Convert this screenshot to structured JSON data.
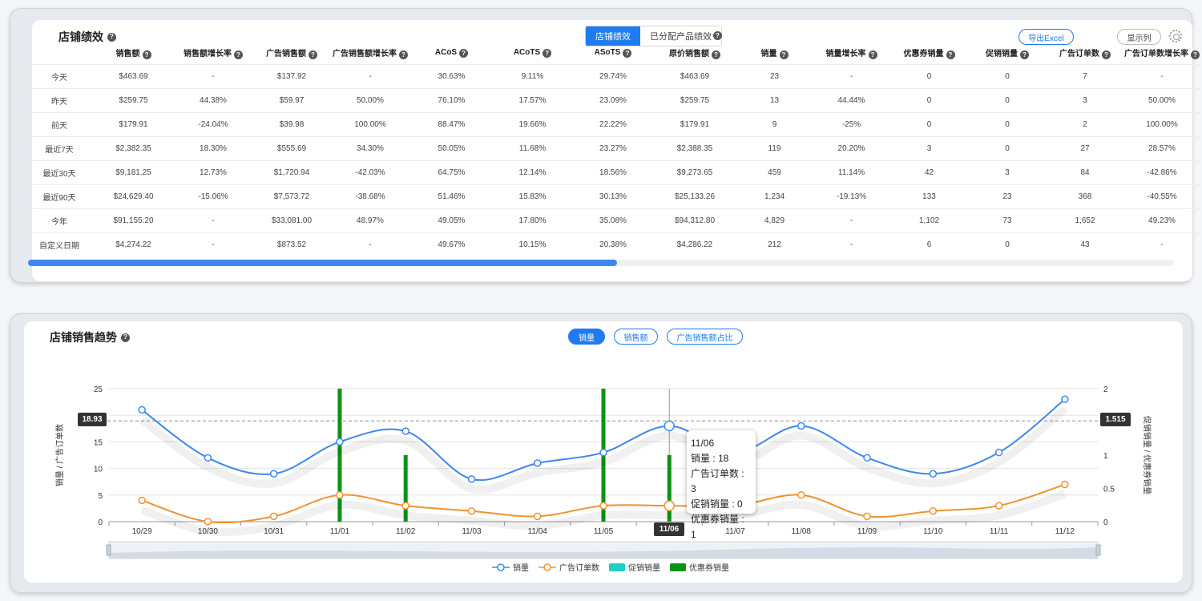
{
  "perf": {
    "title": "店铺绩效",
    "tabs": [
      {
        "label": "店铺绩效",
        "active": true
      },
      {
        "label": "已分配产品绩效",
        "active": false
      }
    ],
    "export_label": "导出Excel",
    "columns_label": "显示列",
    "headers": [
      "销售额",
      "销售额增长率",
      "广告销售额",
      "广告销售额增长率",
      "ACoS",
      "ACoTS",
      "ASoTS",
      "原价销售额",
      "销量",
      "销量增长率",
      "优惠券销量",
      "促销销量",
      "广告订单数",
      "广告订单数增长率"
    ],
    "rows": [
      {
        "label": "今天",
        "cells": [
          "$463.69",
          "-",
          "$137.92",
          "-",
          "30.63%",
          "9.11%",
          "29.74%",
          "$463.69",
          "23",
          "-",
          "0",
          "0",
          "7",
          "-"
        ]
      },
      {
        "label": "昨天",
        "cells": [
          "$259.75",
          "44.38%",
          "$59.97",
          "50.00%",
          "76.10%",
          "17.57%",
          "23.09%",
          "$259.75",
          "13",
          "44.44%",
          "0",
          "0",
          "3",
          "50.00%"
        ]
      },
      {
        "label": "前天",
        "cells": [
          "$179.91",
          "-24.04%",
          "$39.98",
          "100.00%",
          "88.47%",
          "19.66%",
          "22.22%",
          "$179.91",
          "9",
          "-25%",
          "0",
          "0",
          "2",
          "100.00%"
        ]
      },
      {
        "label": "最近7天",
        "cells": [
          "$2,382.35",
          "18.30%",
          "$555.69",
          "34.30%",
          "50.05%",
          "11.68%",
          "23.27%",
          "$2,388.35",
          "119",
          "20.20%",
          "3",
          "0",
          "27",
          "28.57%"
        ]
      },
      {
        "label": "最近30天",
        "cells": [
          "$9,181.25",
          "12.73%",
          "$1,720.94",
          "-42.03%",
          "64.75%",
          "12.14%",
          "18.56%",
          "$9,273.65",
          "459",
          "11.14%",
          "42",
          "3",
          "84",
          "-42.86%"
        ]
      },
      {
        "label": "最近90天",
        "cells": [
          "$24,629.40",
          "-15.06%",
          "$7,573.72",
          "-38.68%",
          "51.46%",
          "15.83%",
          "30.13%",
          "$25,133.26",
          "1,234",
          "-19.13%",
          "133",
          "23",
          "368",
          "-40.55%"
        ]
      },
      {
        "label": "今年",
        "cells": [
          "$91,155.20",
          "-",
          "$33,081.00",
          "48.97%",
          "49.05%",
          "17.80%",
          "35.08%",
          "$94,312.80",
          "4,829",
          "-",
          "1,102",
          "73",
          "1,652",
          "49.23%"
        ]
      },
      {
        "label": "自定义日期",
        "cells": [
          "$4,274.22",
          "-",
          "$873.52",
          "-",
          "49.67%",
          "10.15%",
          "20.38%",
          "$4,286.22",
          "212",
          "-",
          "6",
          "0",
          "43",
          "-"
        ]
      }
    ],
    "scroll_fraction": 0.51
  },
  "trend": {
    "title": "店铺销售趋势",
    "chips": [
      {
        "label": "销量",
        "active": true
      },
      {
        "label": "销售额",
        "active": false
      },
      {
        "label": "广告销售额占比",
        "active": false
      }
    ],
    "tooltip": {
      "date": "11/06",
      "lines": [
        "销量 : 18",
        "广告订单数 : 3",
        "促销销量 : 0",
        "优惠券销量 : 1"
      ]
    },
    "cursor_left_value": "18.93",
    "cursor_right_value": "1.515",
    "cursor_x_label": "11/06"
  },
  "chart_data": {
    "type": "line",
    "x": [
      "10/29",
      "10/30",
      "10/31",
      "11/01",
      "11/02",
      "11/03",
      "11/04",
      "11/05",
      "11/06",
      "11/07",
      "11/08",
      "11/09",
      "11/10",
      "11/11",
      "11/12"
    ],
    "ylabel": "销量 / 广告订单数",
    "y2label": "促销销量 / 优惠券销量",
    "ylim": [
      0,
      25
    ],
    "y2lim": [
      0,
      2
    ],
    "yticks": [
      0,
      5,
      10,
      15,
      20,
      25
    ],
    "y2ticks": [
      0,
      0.5,
      1,
      1.5,
      2
    ],
    "series": [
      {
        "name": "销量",
        "type": "line",
        "axis": "left",
        "color": "#3d87ef",
        "values": [
          21,
          12,
          9,
          15,
          17,
          8,
          11,
          13,
          18,
          13,
          18,
          12,
          9,
          13,
          23
        ]
      },
      {
        "name": "广告订单数",
        "type": "line",
        "axis": "left",
        "color": "#f0922f",
        "values": [
          4,
          0,
          1,
          5,
          3,
          2,
          1,
          3,
          3,
          3,
          5,
          1,
          2,
          3,
          7
        ]
      },
      {
        "name": "促销销量",
        "type": "bar",
        "axis": "right",
        "color": "#1ecfc4",
        "values": [
          0,
          0,
          0,
          0,
          0,
          0,
          0,
          0,
          0,
          0,
          0,
          0,
          0,
          0,
          0
        ]
      },
      {
        "name": "优惠券销量",
        "type": "bar",
        "axis": "right",
        "color": "#0a9416",
        "values": [
          0,
          0,
          0,
          2,
          1,
          0,
          0,
          2,
          1,
          0,
          0,
          0,
          0,
          0,
          0
        ]
      }
    ],
    "grid": true,
    "legend_position": "bottom"
  }
}
